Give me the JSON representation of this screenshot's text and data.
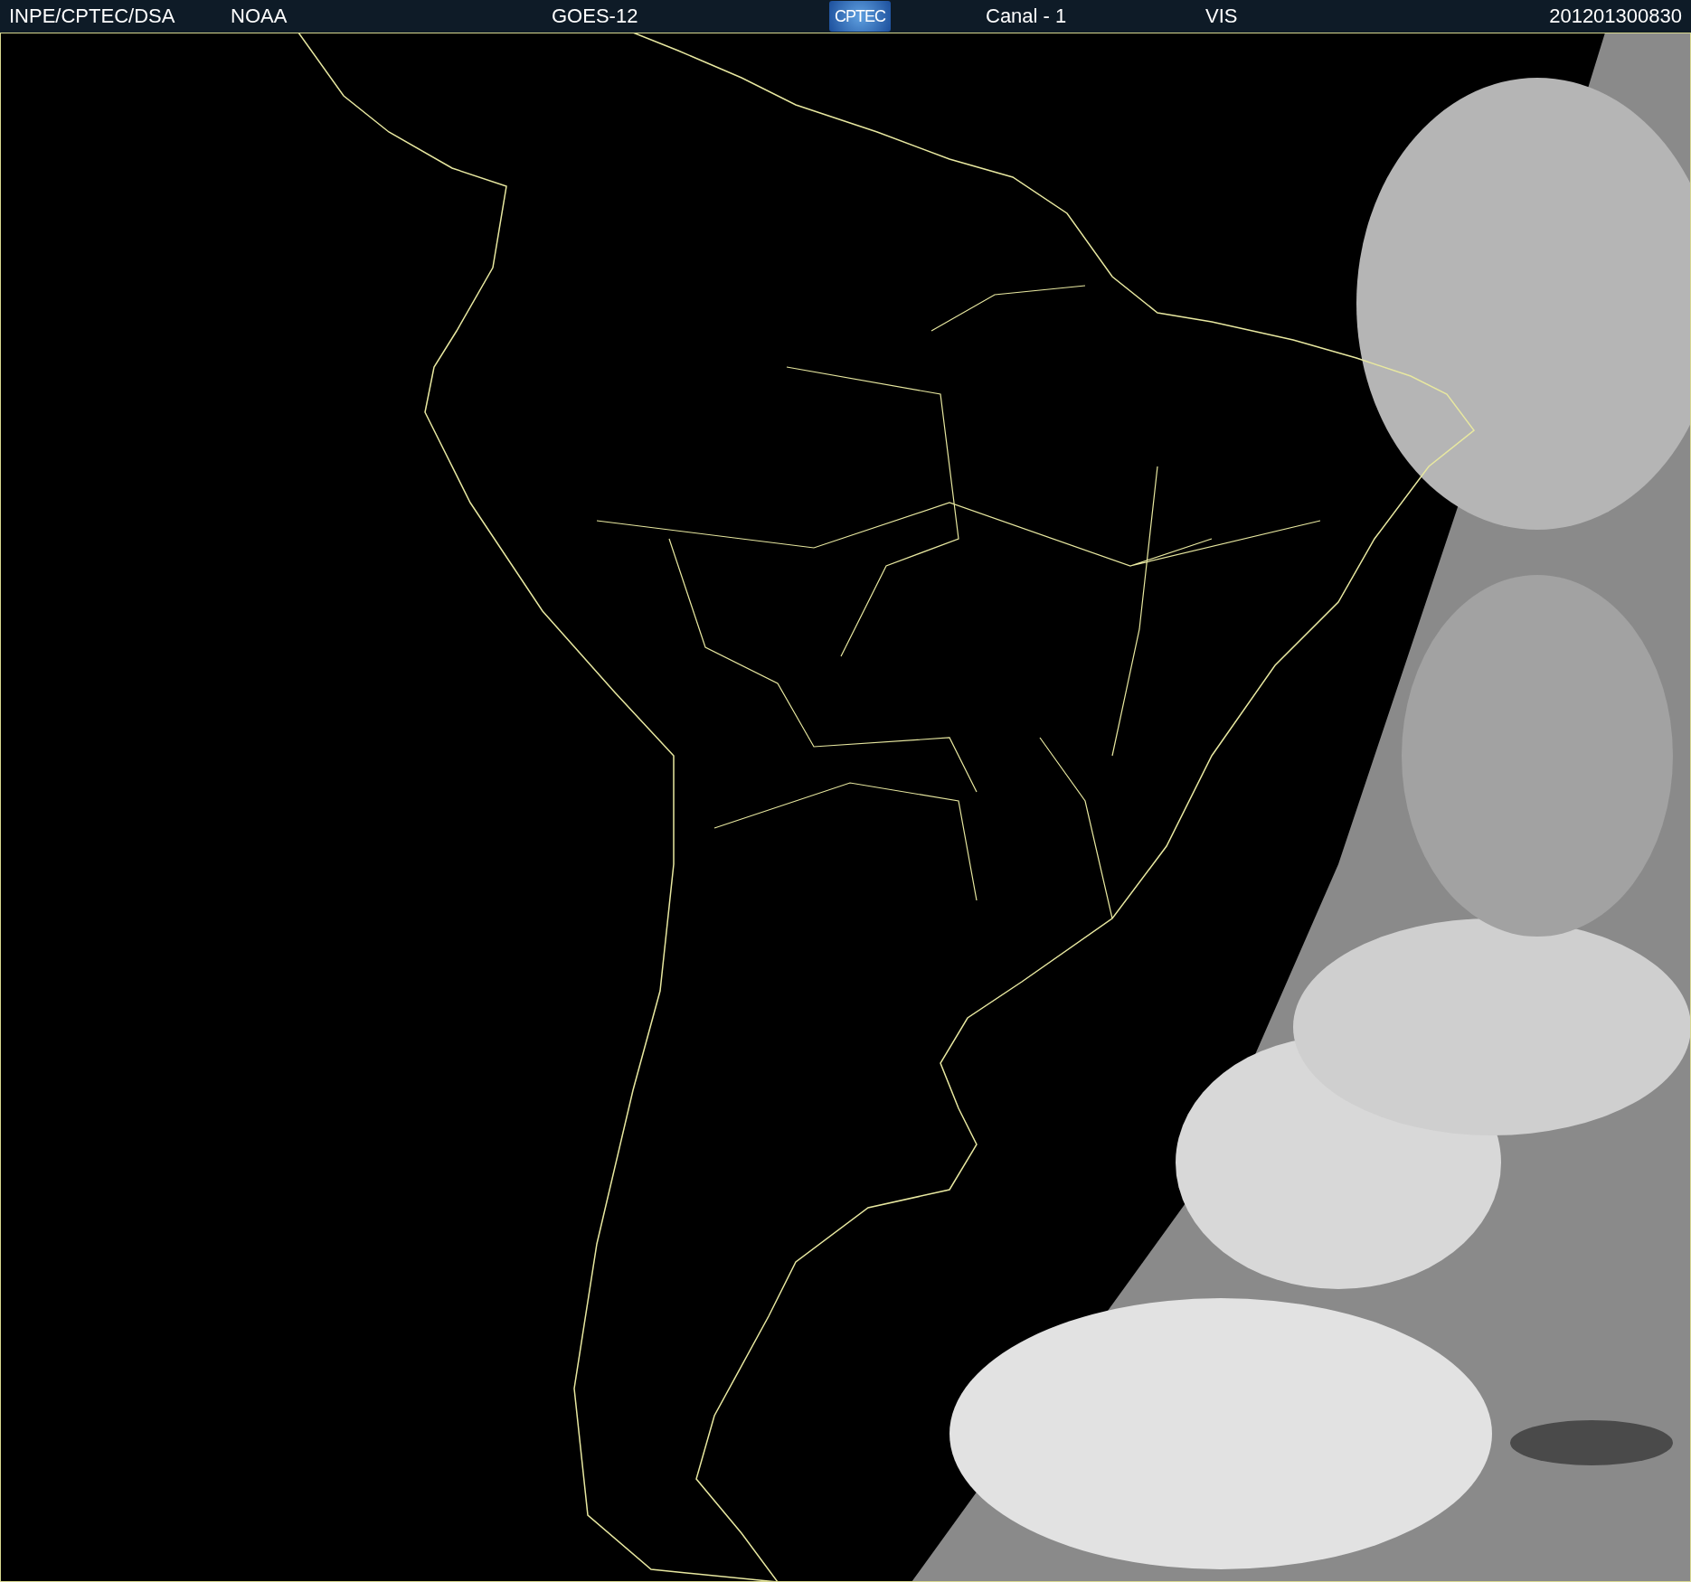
{
  "header": {
    "items": [
      {
        "kind": "text",
        "text": "INPE/CPTEC/DSA"
      },
      {
        "kind": "text",
        "text": "NOAA"
      },
      {
        "kind": "text",
        "text": "GOES-12"
      },
      {
        "kind": "logo",
        "text": "CPTEC"
      },
      {
        "kind": "text",
        "text": "Canal - 1"
      },
      {
        "kind": "text",
        "text": "VIS"
      },
      {
        "kind": "text",
        "text": "201201300830"
      }
    ]
  }
}
